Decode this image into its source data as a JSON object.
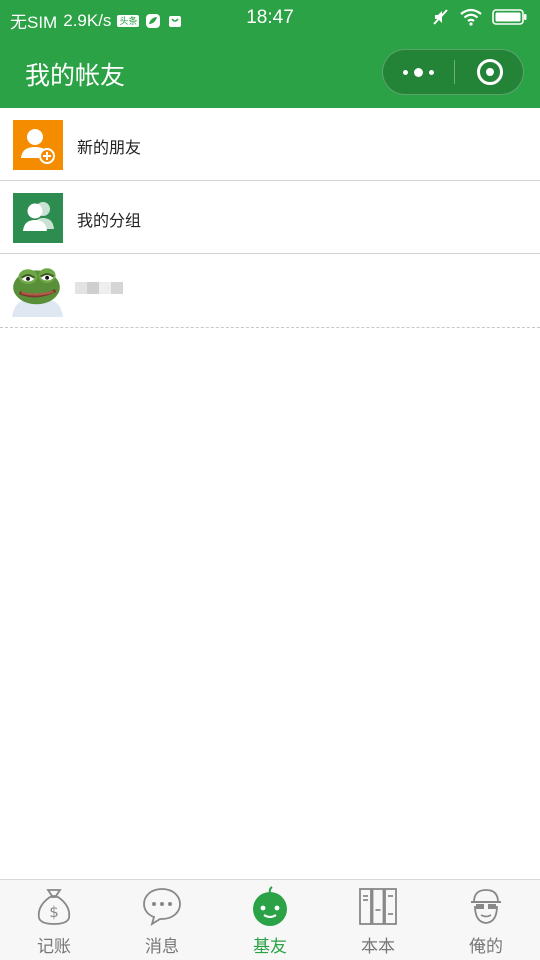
{
  "status_bar": {
    "carrier": "无SIM",
    "speed": "2.9K/s",
    "badge": "头条",
    "time": "18:47"
  },
  "header": {
    "title": "我的帐友"
  },
  "list": {
    "items": [
      {
        "label": "新的朋友",
        "icon": "add-friend-icon",
        "color": "#f58c00"
      },
      {
        "label": "我的分组",
        "icon": "group-icon",
        "color": "#2d8c4f"
      }
    ]
  },
  "tabs": [
    {
      "label": "记账",
      "icon": "money-bag-icon",
      "active": false
    },
    {
      "label": "消息",
      "icon": "chat-bubble-icon",
      "active": false
    },
    {
      "label": "基友",
      "icon": "baby-face-icon",
      "active": true
    },
    {
      "label": "本本",
      "icon": "books-icon",
      "active": false
    },
    {
      "label": "俺的",
      "icon": "cap-face-icon",
      "active": false
    }
  ],
  "colors": {
    "brand": "#2ba245",
    "inactive_tab": "#777777"
  }
}
